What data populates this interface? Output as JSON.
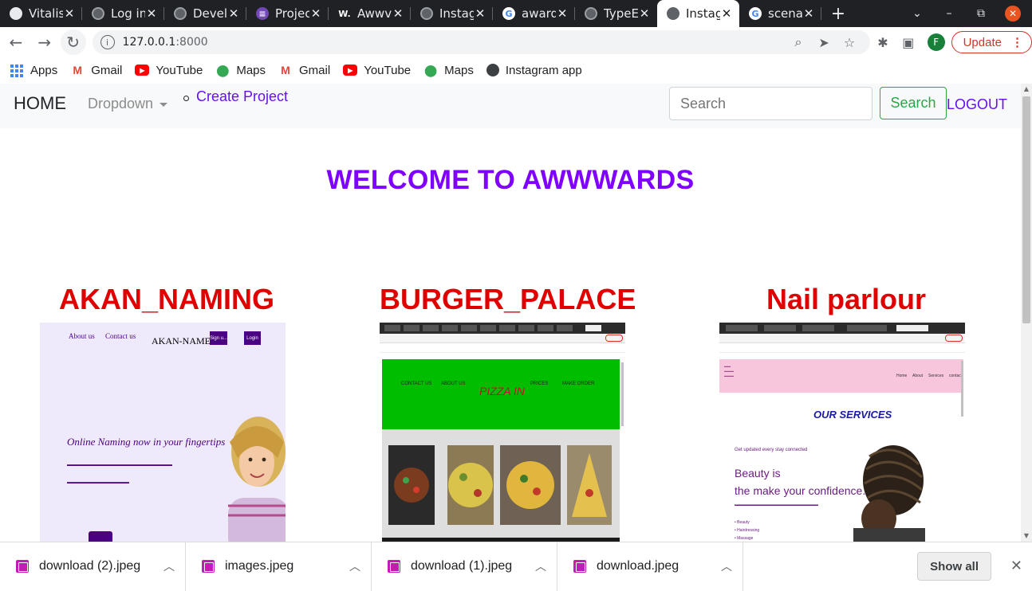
{
  "browser": {
    "tabs": [
      {
        "title": "Vitalis",
        "icon": "github-icon"
      },
      {
        "title": "Log in",
        "icon": "globe-icon"
      },
      {
        "title": "Develo",
        "icon": "globe-icon"
      },
      {
        "title": "Projec",
        "icon": "forms-icon"
      },
      {
        "title": "Awwv",
        "icon": "awwwards-icon"
      },
      {
        "title": "Instag",
        "icon": "globe-icon"
      },
      {
        "title": "award",
        "icon": "google-icon"
      },
      {
        "title": "TypeE",
        "icon": "globe-icon"
      },
      {
        "title": "Instag",
        "icon": "globe-icon",
        "active": true
      },
      {
        "title": "scena",
        "icon": "google-icon"
      }
    ],
    "url_host": "127.0.0.1",
    "url_port": ":8000",
    "profile_initial": "F",
    "update_label": "Update",
    "bookmarks": [
      {
        "label": "Apps",
        "icon": "apps-grid-icon"
      },
      {
        "label": "Gmail",
        "icon": "gmail-icon"
      },
      {
        "label": "YouTube",
        "icon": "youtube-icon"
      },
      {
        "label": "Maps",
        "icon": "maps-icon"
      },
      {
        "label": "Gmail",
        "icon": "gmail-icon"
      },
      {
        "label": "YouTube",
        "icon": "youtube-icon"
      },
      {
        "label": "Maps",
        "icon": "maps-icon"
      },
      {
        "label": "Instagram app",
        "icon": "globe-icon"
      }
    ]
  },
  "site": {
    "nav": {
      "brand": "HOME",
      "dropdown": "Dropdown",
      "create_link": "Create Project",
      "search_placeholder": "Search",
      "search_button": "Search",
      "logout": "LOGOUT"
    },
    "welcome": "WELCOME TO AWWWARDS",
    "projects": [
      {
        "title": "AKAN_NAMING"
      },
      {
        "title": "BURGER_PALACE"
      },
      {
        "title": "Nail parlour"
      }
    ],
    "akan_preview": {
      "nav_about": "About us",
      "nav_contact": "Contact us",
      "logo": "AKAN-NAME",
      "btn_signup": "Sign u...",
      "btn_login": "Login",
      "hero": "Online Naming now in your fingertips"
    },
    "burger_preview": {
      "logo": "PIZZA IN",
      "nav": [
        "CONTACT US",
        "ABOUT US",
        "PRICES",
        "MAKE ORDER"
      ]
    },
    "nail_preview": {
      "nav": [
        "Home",
        "About",
        "Services",
        "contact"
      ],
      "heading": "OUR SERVICES",
      "small": "Get updated every stay connected",
      "beauty_line1": "Beauty is",
      "beauty_line2": "the make your confidence.",
      "list": [
        "Beauty",
        "Hairdressing",
        "Massage"
      ]
    }
  },
  "downloads": {
    "items": [
      {
        "name": "download (2).jpeg"
      },
      {
        "name": "images.jpeg"
      },
      {
        "name": "download (1).jpeg"
      },
      {
        "name": "download.jpeg"
      }
    ],
    "show_all": "Show all"
  },
  "colors": {
    "accent_purple": "#8000ff",
    "project_title_red": "#e00000",
    "link_purple": "#6610f2",
    "success_green": "#28a745"
  }
}
